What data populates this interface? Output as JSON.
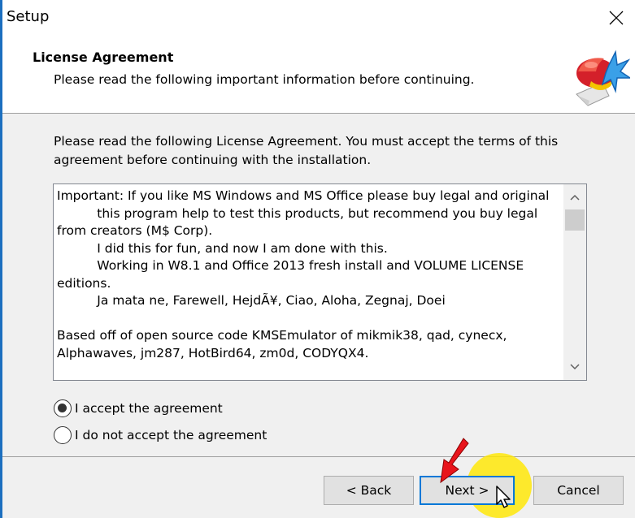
{
  "window": {
    "title": "Setup",
    "close_icon": "close-icon"
  },
  "header": {
    "title": "License Agreement",
    "subtitle": "Please read the following important information before continuing.",
    "logo_icon": "setup-wizard-logo"
  },
  "instructions": "Please read the following License Agreement. You must accept the terms of this agreement before continuing with the installation.",
  "license": {
    "text": "Important: If you like MS Windows and MS Office please buy legal and original\n          this program help to test this products, but recommend you buy legal\nfrom creators (M$ Corp).\n          I did this for fun, and now I am done with this.\n          Working in W8.1 and Office 2013 fresh install and VOLUME LICENSE\neditions.\n          Ja mata ne, Farewell, HejdÃ¥, Ciao, Aloha, Zegnaj, Doei\n\nBased off of open source code KMSEmulator of mikmik38, qad, cynecx,\nAlphawaves, jm287, HotBird64, zm0d, CODYQX4."
  },
  "options": {
    "accept_label": "I accept the agreement",
    "decline_label": "I do not accept the agreement",
    "selected": "accept"
  },
  "buttons": {
    "back": "< Back",
    "next": "Next >",
    "cancel": "Cancel"
  },
  "colors": {
    "accent": "#0078d7",
    "highlight": "#ffe600",
    "annotation_arrow": "#e8141b"
  }
}
